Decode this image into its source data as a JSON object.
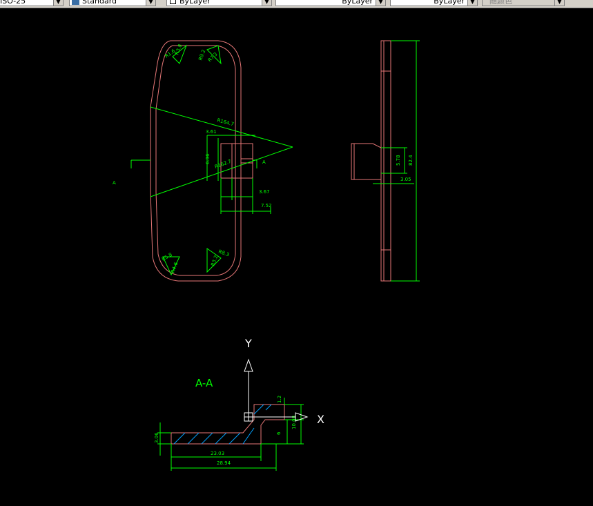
{
  "toolbar": {
    "dimstyle": "ISO-25",
    "textstyle": "Standard",
    "layer": "ByLayer",
    "linetype": "ByLayer",
    "lineweight": "ByLayer",
    "plotstyle": "随颜色"
  },
  "colors": {
    "background": "#000000",
    "outline": "#e87878",
    "dimension": "#00ff00",
    "ucs": "#ffffff"
  },
  "drawing": {
    "front_view": {
      "radius_labels": [
        "R1.6",
        "R3.8",
        "R9.2",
        "R7.3",
        "R164.7",
        "R162.7",
        "R5.8",
        "R4.6",
        "R8.3",
        "R3.2"
      ],
      "dims": [
        "3.61",
        "6.36",
        "3.67",
        "7.52"
      ],
      "section_marks": [
        "A",
        "A"
      ]
    },
    "side_view": {
      "dims": [
        "5.78",
        "3.05",
        "82.4"
      ]
    },
    "section_view": {
      "title": "A-A",
      "dims": [
        "3.06",
        "23.03",
        "28.94",
        "1.2",
        "10.08",
        "6"
      ]
    },
    "ucs": {
      "y_label": "Y",
      "x_label": "X"
    }
  }
}
